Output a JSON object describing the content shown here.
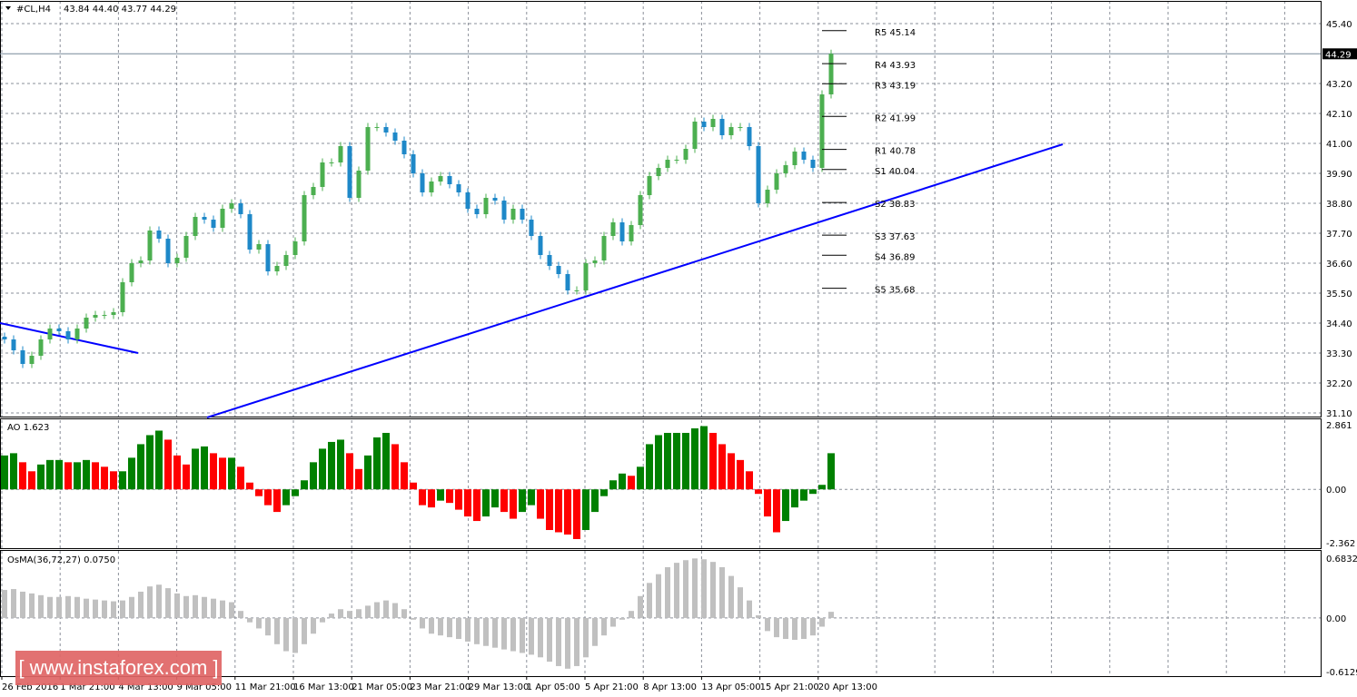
{
  "header": {
    "symbol": "#CL,H4",
    "ohlc": "43.84 44.40 43.77 44.29",
    "menu_icon": "triangle-down-icon"
  },
  "colors": {
    "bull": "#4caf50",
    "bear": "#1e88c8",
    "trendline": "#0000ff",
    "ao_up": "#008000",
    "ao_down": "#ff0000",
    "osma": "#c0c0c0",
    "grid": "#8a8f99",
    "logo_bg": "#e06666"
  },
  "logo": {
    "text": "[ www.instaforex.com ]"
  },
  "chart_data": [
    {
      "type": "candlestick",
      "title": "#CL,H4",
      "ylim": [
        31.1,
        45.4
      ],
      "y_ticks": [
        "45.40",
        "43.20",
        "42.10",
        "41.00",
        "39.90",
        "38.80",
        "37.70",
        "36.60",
        "35.50",
        "34.40",
        "33.30",
        "32.20",
        "31.10"
      ],
      "x_ticks": [
        "26 Feb 2016",
        "1 Mar 21:00",
        "4 Mar 13:00",
        "9 Mar 05:00",
        "11 Mar 21:00",
        "16 Mar 13:00",
        "21 Mar 05:00",
        "23 Mar 21:00",
        "29 Mar 13:00",
        "1 Apr 05:00",
        "5 Apr 21:00",
        "8 Apr 13:00",
        "13 Apr 05:00",
        "15 Apr 21:00",
        "20 Apr 13:00"
      ],
      "current_price": "44.29",
      "closes": [
        33.8,
        33.4,
        32.9,
        33.2,
        33.8,
        34.2,
        34.1,
        33.8,
        34.2,
        34.6,
        34.7,
        34.7,
        34.8,
        35.9,
        36.6,
        36.7,
        37.8,
        37.5,
        36.6,
        36.8,
        37.6,
        38.3,
        38.2,
        37.9,
        38.6,
        38.8,
        38.4,
        37.1,
        37.3,
        36.3,
        36.5,
        36.9,
        37.4,
        39.1,
        39.4,
        40.3,
        40.3,
        40.9,
        39.0,
        40.0,
        41.6,
        41.6,
        41.4,
        41.1,
        40.6,
        39.9,
        39.2,
        39.6,
        39.8,
        39.5,
        39.2,
        38.6,
        38.4,
        39.0,
        38.9,
        38.2,
        38.6,
        38.2,
        37.6,
        36.9,
        36.5,
        36.2,
        35.6,
        35.6,
        36.6,
        36.7,
        37.6,
        38.1,
        37.4,
        38.0,
        39.1,
        39.8,
        40.1,
        40.4,
        40.4,
        40.8,
        41.8,
        41.6,
        41.9,
        41.3,
        41.6,
        41.6,
        40.9,
        38.8,
        39.3,
        39.9,
        40.2,
        40.7,
        40.4,
        40.1,
        42.8,
        44.29
      ],
      "pivots": [
        {
          "label": "R5 45.14",
          "value": 45.14
        },
        {
          "label": "R4 43.93",
          "value": 43.93
        },
        {
          "label": "R3 43.19",
          "value": 43.19
        },
        {
          "label": "R2 41.99",
          "value": 41.99
        },
        {
          "label": "R1 40.78",
          "value": 40.78
        },
        {
          "label": "S1 40.04",
          "value": 40.04
        },
        {
          "label": "S2 38.83",
          "value": 38.83
        },
        {
          "label": "S3 37.63",
          "value": 37.63
        },
        {
          "label": "S4 36.89",
          "value": 36.89
        },
        {
          "label": "S5 35.68",
          "value": 35.68
        }
      ],
      "trendlines": [
        {
          "from": [
            "26 Feb 2016",
            34.4
          ],
          "to": [
            "4 Mar 13:00",
            33.3
          ]
        },
        {
          "from": [
            "11 Mar 21:00",
            31.1
          ],
          "to": [
            "projected",
            40.9
          ]
        }
      ],
      "grid": true
    },
    {
      "type": "bar",
      "title": "AO 1.623",
      "ylim": [
        -2.362,
        2.861
      ],
      "y_ticks": [
        "2.861",
        "0.00",
        "-2.362"
      ],
      "values": [
        1.5,
        1.6,
        1.2,
        0.8,
        1.1,
        1.3,
        1.3,
        1.2,
        1.2,
        1.3,
        1.2,
        1.0,
        0.8,
        0.8,
        1.4,
        2.0,
        2.4,
        2.6,
        2.2,
        1.5,
        1.1,
        1.8,
        1.9,
        1.6,
        1.4,
        1.4,
        1.0,
        0.3,
        -0.3,
        -0.7,
        -1.0,
        -0.7,
        -0.3,
        0.4,
        1.2,
        1.8,
        2.1,
        2.2,
        1.6,
        0.9,
        1.5,
        2.3,
        2.5,
        2.0,
        1.2,
        0.3,
        -0.7,
        -0.8,
        -0.5,
        -0.6,
        -0.9,
        -1.2,
        -1.4,
        -1.2,
        -0.8,
        -1.0,
        -1.3,
        -1.0,
        -0.7,
        -1.3,
        -1.8,
        -1.9,
        -2.0,
        -2.2,
        -1.8,
        -1.0,
        -0.3,
        0.4,
        0.7,
        0.6,
        1.0,
        2.0,
        2.4,
        2.5,
        2.5,
        2.5,
        2.7,
        2.8,
        2.5,
        2.0,
        1.6,
        1.3,
        0.8,
        -0.2,
        -1.2,
        -1.9,
        -1.4,
        -0.8,
        -0.5,
        -0.2,
        0.2,
        1.6
      ]
    },
    {
      "type": "bar",
      "title": "OsMA(36,72,27) 0.0750",
      "ylim": [
        -0.6129,
        0.6832
      ],
      "y_ticks": [
        "0.6832",
        "0.00",
        "-0.6129"
      ],
      "values": [
        0.32,
        0.33,
        0.3,
        0.28,
        0.26,
        0.24,
        0.24,
        0.25,
        0.24,
        0.22,
        0.21,
        0.2,
        0.19,
        0.2,
        0.24,
        0.3,
        0.36,
        0.38,
        0.34,
        0.28,
        0.25,
        0.26,
        0.24,
        0.22,
        0.2,
        0.18,
        0.08,
        -0.05,
        -0.12,
        -0.2,
        -0.3,
        -0.38,
        -0.4,
        -0.3,
        -0.18,
        -0.05,
        0.05,
        0.1,
        0.08,
        0.1,
        0.14,
        0.18,
        0.2,
        0.17,
        0.1,
        -0.02,
        -0.12,
        -0.18,
        -0.2,
        -0.22,
        -0.24,
        -0.27,
        -0.3,
        -0.32,
        -0.34,
        -0.36,
        -0.38,
        -0.4,
        -0.42,
        -0.45,
        -0.5,
        -0.55,
        -0.58,
        -0.55,
        -0.45,
        -0.32,
        -0.2,
        -0.1,
        -0.02,
        0.08,
        0.25,
        0.4,
        0.5,
        0.58,
        0.63,
        0.66,
        0.68,
        0.67,
        0.64,
        0.58,
        0.48,
        0.35,
        0.2,
        0.03,
        -0.15,
        -0.22,
        -0.24,
        -0.25,
        -0.24,
        -0.2,
        -0.1,
        0.07
      ]
    }
  ]
}
